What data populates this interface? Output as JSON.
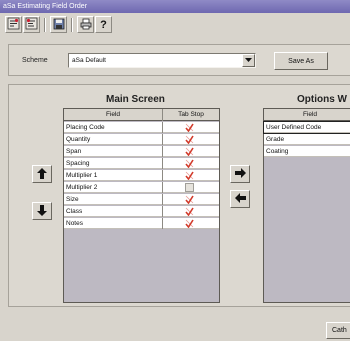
{
  "window": {
    "title": "aSa Estimating Field Order"
  },
  "toolbar": {
    "buttons": [
      {
        "icon": "field-order-icon"
      },
      {
        "icon": "field-order-alt-icon"
      },
      {
        "icon": "save-icon"
      },
      {
        "icon": "print-icon"
      },
      {
        "icon": "help-icon"
      }
    ]
  },
  "scheme": {
    "label": "Scheme",
    "value": "aSa Default",
    "save_as_label": "Save As"
  },
  "main_screen": {
    "title": "Main Screen",
    "columns": [
      "Field",
      "Tab Stop"
    ],
    "rows": [
      {
        "field": "Placing Code",
        "tab_stop": true
      },
      {
        "field": "Quantity",
        "tab_stop": true
      },
      {
        "field": "Span",
        "tab_stop": true
      },
      {
        "field": "Spacing",
        "tab_stop": true
      },
      {
        "field": "Multiplier 1",
        "tab_stop": true
      },
      {
        "field": "Multiplier 2",
        "tab_stop": false
      },
      {
        "field": "Size",
        "tab_stop": true
      },
      {
        "field": "Class",
        "tab_stop": true
      },
      {
        "field": "Notes",
        "tab_stop": true
      }
    ]
  },
  "options_window": {
    "title": "Options W",
    "columns": [
      "Field"
    ],
    "rows": [
      {
        "field": "User Defined Code"
      },
      {
        "field": "Grade"
      },
      {
        "field": "Coating"
      }
    ]
  },
  "status": {
    "button_label": "Cath"
  },
  "colors": {
    "check": "#d23a2a",
    "title_bar": "#7a74b8"
  }
}
